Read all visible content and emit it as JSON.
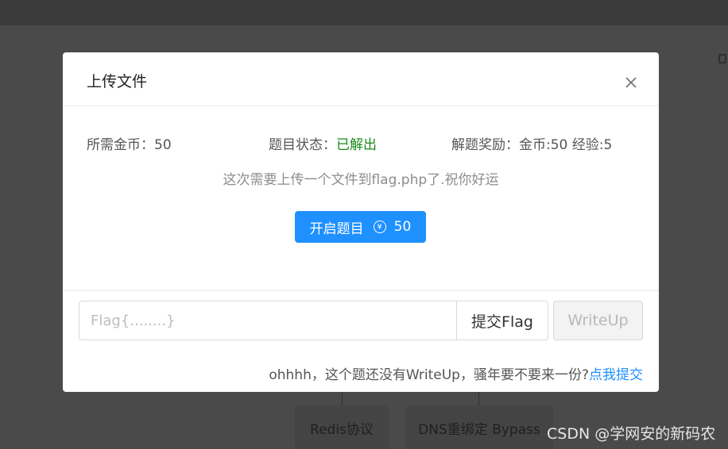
{
  "modal": {
    "title": "上传文件",
    "required_coins_label": "所需金币：",
    "required_coins_value": "50",
    "status_label": "题目状态：",
    "status_value": "已解出",
    "reward_label": "解题奖励：",
    "reward_value": "金币:50 经验:5",
    "description": "这次需要上传一个文件到flag.php了.祝你好运",
    "open_button_label": "开启题目",
    "open_button_cost": "50",
    "flag_placeholder": "Flag{........}",
    "flag_value": "",
    "submit_label": "提交Flag",
    "writeup_label": "WriteUp",
    "footer_text": "ohhhh，这个题还没有WriteUp，骚年要不要来一份?",
    "footer_link": "点我提交"
  },
  "background": {
    "nodes": [
      "Redis协议",
      "DNS重绑定 Bypass"
    ]
  },
  "watermark": "CSDN @学网安的新码农",
  "colors": {
    "primary": "#1e90ff",
    "success": "#188a18",
    "overlay": "#4a4a4a"
  },
  "icons": {
    "close": "close-icon",
    "coin": "yen-coin-icon"
  }
}
